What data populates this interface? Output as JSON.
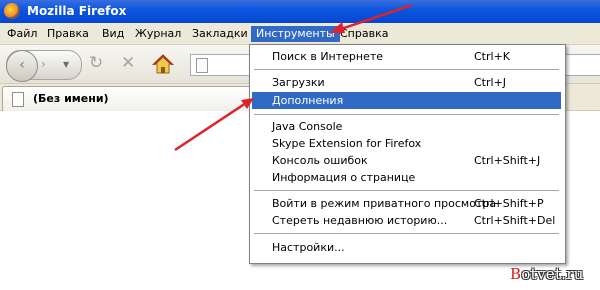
{
  "window": {
    "title": "Mozilla Firefox"
  },
  "menubar": {
    "items": [
      {
        "label": "Файл"
      },
      {
        "label": "Правка"
      },
      {
        "label": "Вид"
      },
      {
        "label": "Журнал"
      },
      {
        "label": "Закладки"
      },
      {
        "label": "Инструменты",
        "active": true
      },
      {
        "label": "Справка"
      }
    ]
  },
  "toolbar": {
    "icons": {
      "back": "back-arrow-icon",
      "forward": "forward-arrow-icon",
      "history": "dropdown-triangle-icon",
      "reload": "reload-icon",
      "stop": "stop-x-icon",
      "home": "home-icon",
      "page": "page-icon"
    },
    "glyphs": {
      "back": "‹",
      "forward": "›",
      "history": "▼",
      "reload": "↻",
      "stop": "✕"
    }
  },
  "tabs": [
    {
      "label": "(Без имени)"
    }
  ],
  "tools_menu": {
    "items": [
      {
        "label": "Поиск в Интернете",
        "shortcut": "Ctrl+K"
      },
      {
        "label": "Загрузки",
        "shortcut": "Ctrl+J"
      },
      {
        "label": "Дополнения",
        "shortcut": "",
        "highlighted": true
      },
      {
        "label": "Java Console",
        "shortcut": ""
      },
      {
        "label": "Skype Extension for Firefox",
        "shortcut": ""
      },
      {
        "label": "Консоль ошибок",
        "shortcut": "Ctrl+Shift+J"
      },
      {
        "label": "Информация о странице",
        "shortcut": ""
      },
      {
        "label": "Войти в режим приватного просмотра",
        "shortcut": "Ctrl+Shift+P"
      },
      {
        "label": "Стереть недавнюю историю...",
        "shortcut": "Ctrl+Shift+Del"
      },
      {
        "label": "Настройки...",
        "shortcut": ""
      }
    ]
  },
  "annotations": {
    "arrow_color": "#e0202a"
  },
  "watermark": {
    "first_letter": "B",
    "rest": "otvet.ru"
  },
  "colors": {
    "titlebar": "#0a54de",
    "menu_highlight": "#316ac5",
    "chrome_bg": "#ece9d8"
  }
}
